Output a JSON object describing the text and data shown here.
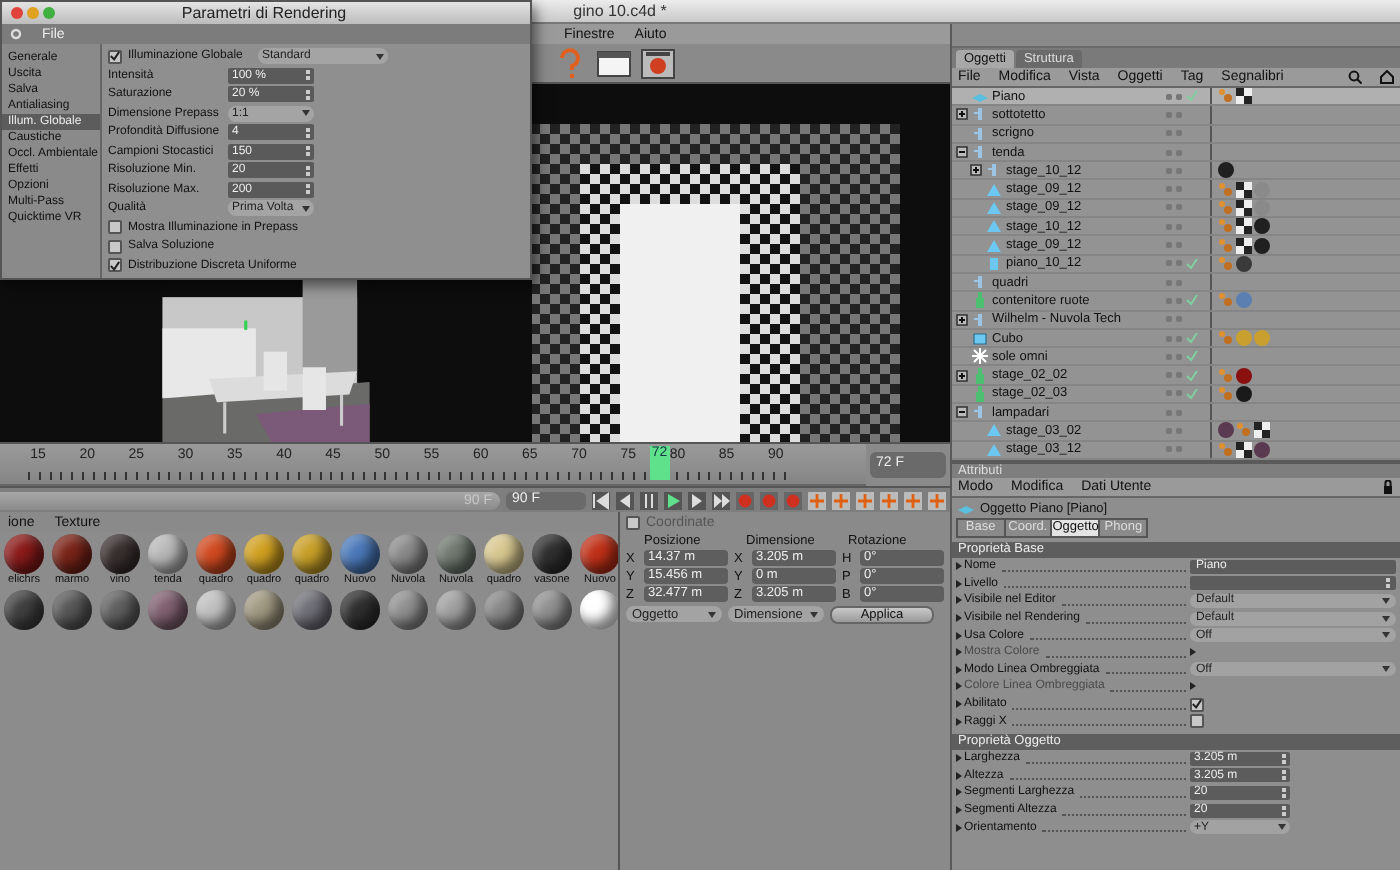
{
  "app": {
    "title": "gino 10.c4d *",
    "menu": [
      "Finestre",
      "Aiuto"
    ]
  },
  "render_settings": {
    "title": "Parametri di Rendering",
    "menu": [
      "File"
    ],
    "sections": [
      {
        "label": "Generale",
        "selected": false
      },
      {
        "label": "Uscita",
        "selected": false
      },
      {
        "label": "Salva",
        "selected": false
      },
      {
        "label": "Antialiasing",
        "selected": false
      },
      {
        "label": "Illum. Globale",
        "selected": true
      },
      {
        "label": "Caustiche",
        "selected": false
      },
      {
        "label": "Occl. Ambientale",
        "selected": false
      },
      {
        "label": "Effetti",
        "selected": false
      },
      {
        "label": "Opzioni",
        "selected": false
      },
      {
        "label": "Multi-Pass",
        "selected": false
      },
      {
        "label": "Quicktime VR",
        "selected": false
      }
    ],
    "gi": {
      "label": "Illuminazione Globale",
      "checked": true,
      "preset": "Standard"
    },
    "fields": [
      {
        "kind": "number",
        "label": "Intensità",
        "value": "100 %"
      },
      {
        "kind": "number",
        "label": "Saturazione",
        "value": "20 %"
      },
      {
        "kind": "dropdown",
        "label": "Dimensione Prepass",
        "value": "1:1"
      },
      {
        "kind": "number",
        "label": "Profondità Diffusione",
        "value": "4"
      },
      {
        "kind": "number",
        "label": "Campioni Stocastici",
        "value": "150"
      },
      {
        "kind": "number",
        "label": "Risoluzione Min.",
        "value": "20"
      },
      {
        "kind": "number",
        "label": "Risoluzione Max.",
        "value": "200"
      },
      {
        "kind": "dropdown",
        "label": "Qualità",
        "value": "Prima Volta"
      }
    ],
    "options": [
      {
        "label": "Mostra Illuminazione in Prepass",
        "checked": false
      },
      {
        "label": "Salva Soluzione",
        "checked": false
      },
      {
        "label": "Distribuzione Discreta Uniforme",
        "checked": true
      }
    ]
  },
  "objects": {
    "tabs": [
      {
        "label": "Oggetti",
        "selected": true
      },
      {
        "label": "Struttura",
        "selected": false
      }
    ],
    "menu": [
      "File",
      "Modifica",
      "Vista",
      "Oggetti",
      "Tag",
      "Segnalibri"
    ],
    "tree": [
      {
        "name": "Piano",
        "kind": "plane",
        "selected": true,
        "enabled": true,
        "tags": [
          {
            "kind": "phong"
          },
          {
            "kind": "texture"
          }
        ]
      },
      {
        "name": "sottotetto",
        "kind": "group",
        "selected": false,
        "enabled": false,
        "expanded": false
      },
      {
        "name": "scrigno",
        "kind": "group",
        "selected": false,
        "enabled": false
      },
      {
        "name": "tenda",
        "kind": "group",
        "selected": false,
        "enabled": false,
        "expanded": true,
        "children": [
          {
            "name": "stage_10_12",
            "kind": "group",
            "selected": false,
            "enabled": false,
            "expanded": false,
            "tags": [
              {
                "kind": "material",
                "color": "#202020"
              }
            ]
          },
          {
            "name": "stage_09_12",
            "kind": "polygon",
            "selected": false,
            "enabled": false,
            "tags": [
              {
                "kind": "phong"
              },
              {
                "kind": "texture"
              },
              {
                "kind": "material",
                "color": "#8a8a8a"
              }
            ]
          },
          {
            "name": "stage_09_12",
            "kind": "polygon",
            "selected": false,
            "enabled": false,
            "tags": [
              {
                "kind": "phong"
              },
              {
                "kind": "texture"
              },
              {
                "kind": "material",
                "color": "#8a8a8a"
              }
            ]
          },
          {
            "name": "stage_10_12",
            "kind": "polygon",
            "selected": false,
            "enabled": false,
            "tags": [
              {
                "kind": "phong"
              },
              {
                "kind": "texture"
              },
              {
                "kind": "material",
                "color": "#202020"
              }
            ]
          },
          {
            "name": "stage_09_12",
            "kind": "polygon",
            "selected": false,
            "enabled": false,
            "tags": [
              {
                "kind": "phong"
              },
              {
                "kind": "texture"
              },
              {
                "kind": "material",
                "color": "#202020"
              }
            ]
          },
          {
            "name": "piano_10_12",
            "kind": "cylinder",
            "selected": false,
            "enabled": true,
            "tags": [
              {
                "kind": "phong"
              },
              {
                "kind": "material",
                "color": "#3a3a3a"
              }
            ]
          }
        ]
      },
      {
        "name": "quadri",
        "kind": "group",
        "selected": false,
        "enabled": false
      },
      {
        "name": "contenitore ruote",
        "kind": "figure",
        "selected": false,
        "enabled": true,
        "tags": [
          {
            "kind": "phong"
          },
          {
            "kind": "material",
            "color": "#5a7fb0"
          }
        ]
      },
      {
        "name": "Wilhelm - Nuvola Tech",
        "kind": "group",
        "selected": false,
        "enabled": false,
        "expanded": false
      },
      {
        "name": "Cubo",
        "kind": "cube",
        "selected": false,
        "enabled": true,
        "tags": [
          {
            "kind": "phong"
          },
          {
            "kind": "material",
            "color": "#c9a030"
          },
          {
            "kind": "material",
            "color": "#c9a030"
          }
        ]
      },
      {
        "name": "sole omni",
        "kind": "light",
        "selected": false,
        "enabled": true
      },
      {
        "name": "stage_02_02",
        "kind": "figure",
        "selected": false,
        "enabled": true,
        "expanded": false,
        "tags": [
          {
            "kind": "phong"
          },
          {
            "kind": "material",
            "color": "#8a1010"
          }
        ]
      },
      {
        "name": "stage_02_03",
        "kind": "figure",
        "selected": false,
        "enabled": true,
        "tags": [
          {
            "kind": "phong"
          },
          {
            "kind": "material",
            "color": "#1a1a1a"
          }
        ]
      },
      {
        "name": "lampadari",
        "kind": "group",
        "selected": false,
        "enabled": false,
        "expanded": true,
        "children": [
          {
            "name": "stage_03_02",
            "kind": "polygon",
            "selected": false,
            "enabled": false,
            "tags": [
              {
                "kind": "material",
                "color": "#5a3a50"
              },
              {
                "kind": "phong"
              },
              {
                "kind": "texture"
              }
            ]
          },
          {
            "name": "stage_03_12",
            "kind": "polygon",
            "selected": false,
            "enabled": false,
            "tags": [
              {
                "kind": "phong"
              },
              {
                "kind": "texture"
              },
              {
                "kind": "material",
                "color": "#5a3a50"
              }
            ]
          }
        ]
      }
    ]
  },
  "attributes": {
    "title": "Attributi",
    "menu": [
      "Modo",
      "Modifica",
      "Dati Utente"
    ],
    "object": "Oggetto Piano [Piano]",
    "tabs": [
      {
        "label": "Base",
        "selected": false
      },
      {
        "label": "Coord.",
        "selected": false
      },
      {
        "label": "Oggetto",
        "selected": true
      },
      {
        "label": "Phong",
        "selected": false
      }
    ],
    "sections": [
      {
        "title": "Proprietà Base",
        "rows": [
          {
            "kind": "text",
            "label": "Nome",
            "value": "Piano"
          },
          {
            "kind": "text",
            "label": "Livello"
          },
          {
            "kind": "dropdown",
            "label": "Visibile nel Editor",
            "value": "Default"
          },
          {
            "kind": "dropdown",
            "label": "Visibile nel Rendering",
            "value": "Default"
          },
          {
            "kind": "dropdown",
            "label": "Usa Colore",
            "value": "Off"
          },
          {
            "kind": "inactive",
            "label": "Mostra Colore"
          },
          {
            "kind": "dropdown",
            "label": "Modo Linea Ombreggiata",
            "value": "Off"
          },
          {
            "kind": "inactive",
            "label": "Colore Linea Ombreggiata"
          },
          {
            "kind": "check",
            "label": "Abilitato",
            "checked": true
          },
          {
            "kind": "check",
            "label": "Raggi X",
            "checked": false
          }
        ]
      },
      {
        "title": "Proprietà Oggetto",
        "rows": [
          {
            "kind": "number",
            "label": "Larghezza",
            "value": "3.205 m"
          },
          {
            "kind": "number",
            "label": "Altezza",
            "value": "3.205 m"
          },
          {
            "kind": "number",
            "label": "Segmenti Larghezza",
            "value": "20"
          },
          {
            "kind": "number",
            "label": "Segmenti Altezza",
            "value": "20"
          },
          {
            "kind": "dropdown",
            "label": "Orientamento",
            "value": "+Y"
          }
        ]
      }
    ]
  },
  "timeline": {
    "ticks": [
      "15",
      "20",
      "25",
      "30",
      "35",
      "40",
      "45",
      "50",
      "55",
      "60",
      "65",
      "70",
      "75",
      "80",
      "85",
      "90"
    ],
    "playhead": {
      "label": "72",
      "level": 0.75
    },
    "frame": "72 F",
    "end_hint": "90 F",
    "end": "90 F"
  },
  "materials": {
    "menu": [
      "ione",
      "Texture"
    ],
    "items": [
      {
        "name": "elichrs",
        "color": "#8a1a1a"
      },
      {
        "name": "marmo",
        "color": "#7a2418"
      },
      {
        "name": "vino",
        "color": "#3a3030"
      },
      {
        "name": "tenda",
        "color": "#b8b8b8"
      },
      {
        "name": "quadro",
        "color": "#d04a20"
      },
      {
        "name": "quadro",
        "color": "#d0a020"
      },
      {
        "name": "quadro",
        "color": "#c8a028"
      },
      {
        "name": "Nuovo",
        "color": "#4a78b8"
      },
      {
        "name": "Nuvola",
        "color": "#8a8a8a"
      },
      {
        "name": "Nuvola",
        "color": "#707870"
      },
      {
        "name": "quadro",
        "color": "#d8c890"
      },
      {
        "name": "vasone",
        "color": "#303030"
      },
      {
        "name": "Nuovo",
        "color": "#c03018"
      }
    ],
    "row_2": [
      {
        "color": "#404040"
      },
      {
        "color": "#585858"
      },
      {
        "color": "#606060"
      },
      {
        "color": "#806070"
      },
      {
        "color": "#c0c0c0"
      },
      {
        "color": "#a09880"
      },
      {
        "color": "#707078"
      },
      {
        "color": "#303030"
      },
      {
        "color": "#909090"
      },
      {
        "color": "#a0a0a0"
      },
      {
        "color": "#888888"
      },
      {
        "color": "#909090"
      },
      {
        "color": "#ffffff"
      }
    ]
  },
  "coordinates": {
    "title": "Coordinate",
    "checked": false,
    "columns": [
      "Posizione",
      "Dimensione",
      "Rotazione"
    ],
    "rows": [
      {
        "axes": [
          "X",
          "X",
          "H"
        ],
        "values": [
          "14.37 m",
          "3.205 m",
          "0°"
        ]
      },
      {
        "axes": [
          "Y",
          "Y",
          "P"
        ],
        "values": [
          "15.456 m",
          "0 m",
          "0°"
        ]
      },
      {
        "axes": [
          "Z",
          "Z",
          "B"
        ],
        "values": [
          "32.477 m",
          "3.205 m",
          "0°"
        ]
      }
    ],
    "modes": [
      "Oggetto",
      "Dimensione"
    ],
    "apply": "Applica"
  }
}
